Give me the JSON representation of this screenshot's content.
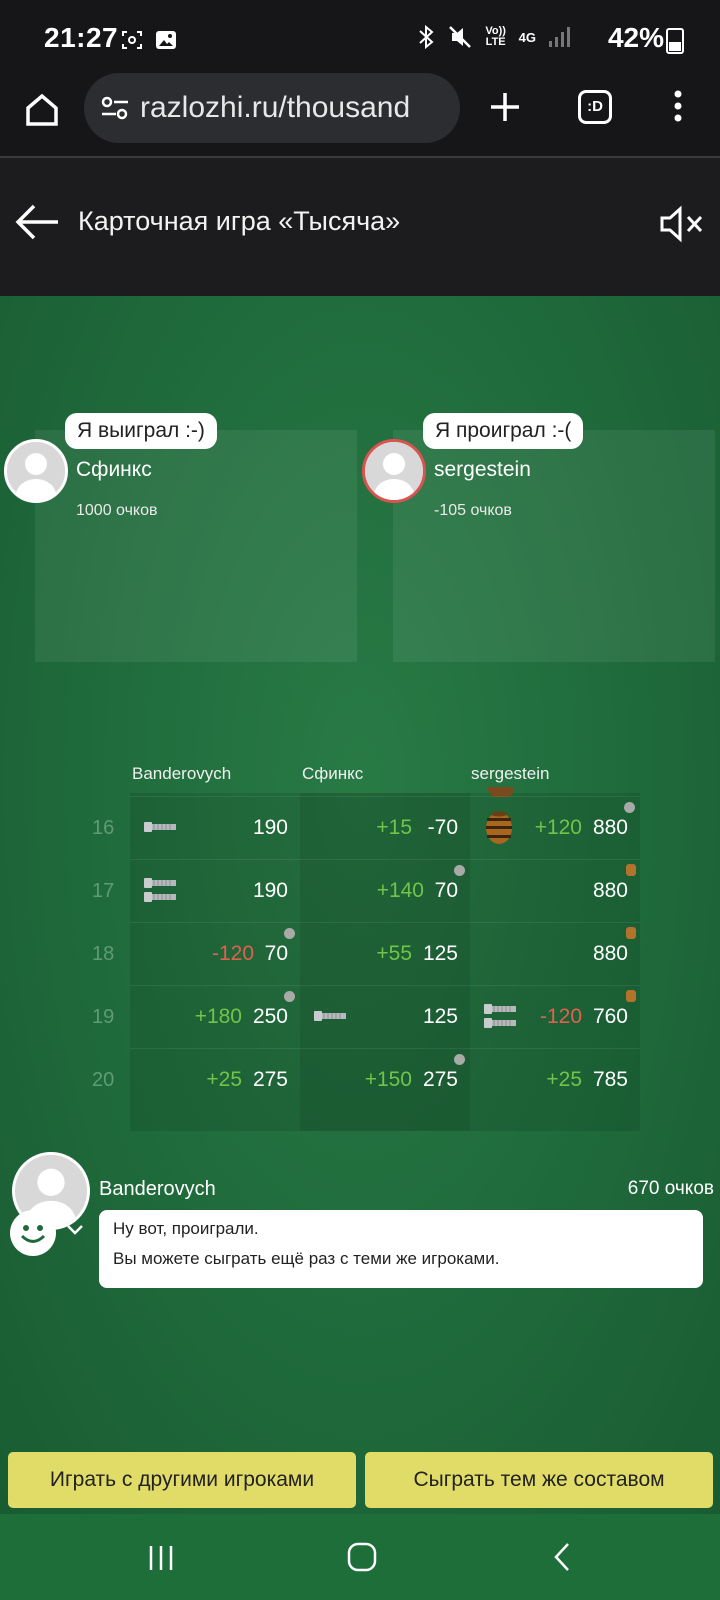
{
  "status_bar": {
    "time": "21:27",
    "battery": "42%",
    "volte": "Vo)) LTE",
    "network": "4G"
  },
  "browser": {
    "url": "razlozhi.ru/thousand",
    "tabs_label": ":D"
  },
  "app_header": {
    "title": "Карточная игра «Тысяча»"
  },
  "players_top": [
    {
      "name": "Сфинкс",
      "score": "1000 очков",
      "bubble": "Я выиграл :-)"
    },
    {
      "name": "sergestein",
      "score": "-105 очков",
      "bubble": "Я проиграл :-("
    }
  ],
  "score_table": {
    "columns": [
      "Banderovych",
      "Сфинкс",
      "sergestein"
    ],
    "rows": [
      {
        "n": "16",
        "cells": [
          {
            "icon": "bolt-icon",
            "delta": "",
            "value": "190",
            "marker": ""
          },
          {
            "icon": "",
            "delta": "+15",
            "value": "-70",
            "marker": ""
          },
          {
            "icon": "barrel-icon",
            "delta": "+120",
            "value": "880",
            "marker": "dot"
          }
        ]
      },
      {
        "n": "17",
        "cells": [
          {
            "icon": "double-bolt-icon",
            "delta": "",
            "value": "190",
            "marker": ""
          },
          {
            "icon": "",
            "delta": "+140",
            "value": "70",
            "marker": "dot"
          },
          {
            "icon": "",
            "delta": "",
            "value": "880",
            "marker": "barrel"
          }
        ]
      },
      {
        "n": "18",
        "cells": [
          {
            "icon": "",
            "delta": "-120",
            "value": "70",
            "marker": "dot"
          },
          {
            "icon": "",
            "delta": "+55",
            "value": "125",
            "marker": ""
          },
          {
            "icon": "",
            "delta": "",
            "value": "880",
            "marker": "barrel"
          }
        ]
      },
      {
        "n": "19",
        "cells": [
          {
            "icon": "",
            "delta": "+180",
            "value": "250",
            "marker": "dot"
          },
          {
            "icon": "bolt-icon",
            "delta": "",
            "value": "125",
            "marker": ""
          },
          {
            "icon": "double-bolt-icon",
            "delta": "-120",
            "value": "760",
            "marker": "barrel"
          }
        ]
      },
      {
        "n": "20",
        "cells": [
          {
            "icon": "",
            "delta": "+25",
            "value": "275",
            "marker": ""
          },
          {
            "icon": "",
            "delta": "+150",
            "value": "275",
            "marker": "dot"
          },
          {
            "icon": "",
            "delta": "+25",
            "value": "785",
            "marker": ""
          }
        ]
      }
    ]
  },
  "chat": {
    "name": "Banderovych",
    "score": "670 очков",
    "lines": [
      "Ну вот, проиграли.",
      "Вы можете сыграть ещё раз с теми же игроками."
    ]
  },
  "buttons": {
    "play_others": "Играть с другими игроками",
    "play_same": "Сыграть тем же составом"
  },
  "colors": {
    "felt": "#1f6a3b",
    "button": "#e1dc67",
    "positive": "#72c449",
    "negative": "#e0614f",
    "loser_ring": "#d9534f"
  }
}
